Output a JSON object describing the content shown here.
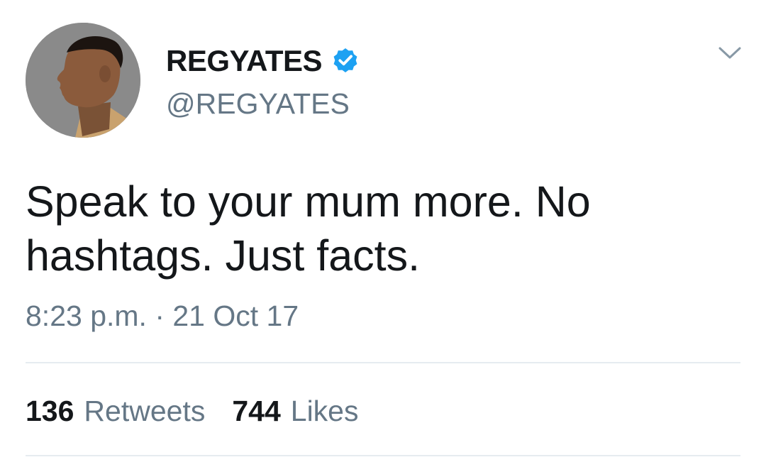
{
  "author": {
    "display_name": "REGYATES",
    "handle": "@REGYATES",
    "verified": true,
    "avatar_icon": "profile-photo"
  },
  "tweet": {
    "text": "Speak to your mum more. No hashtags. Just facts.",
    "timestamp": "8:23 p.m. · 21 Oct 17"
  },
  "stats": {
    "retweets_count": "136",
    "retweets_label": "Retweets",
    "likes_count": "744",
    "likes_label": "Likes"
  },
  "colors": {
    "verified_blue": "#1da1f2",
    "secondary_text": "#657786",
    "primary_text": "#14171a",
    "divider": "#e6ecf0"
  }
}
